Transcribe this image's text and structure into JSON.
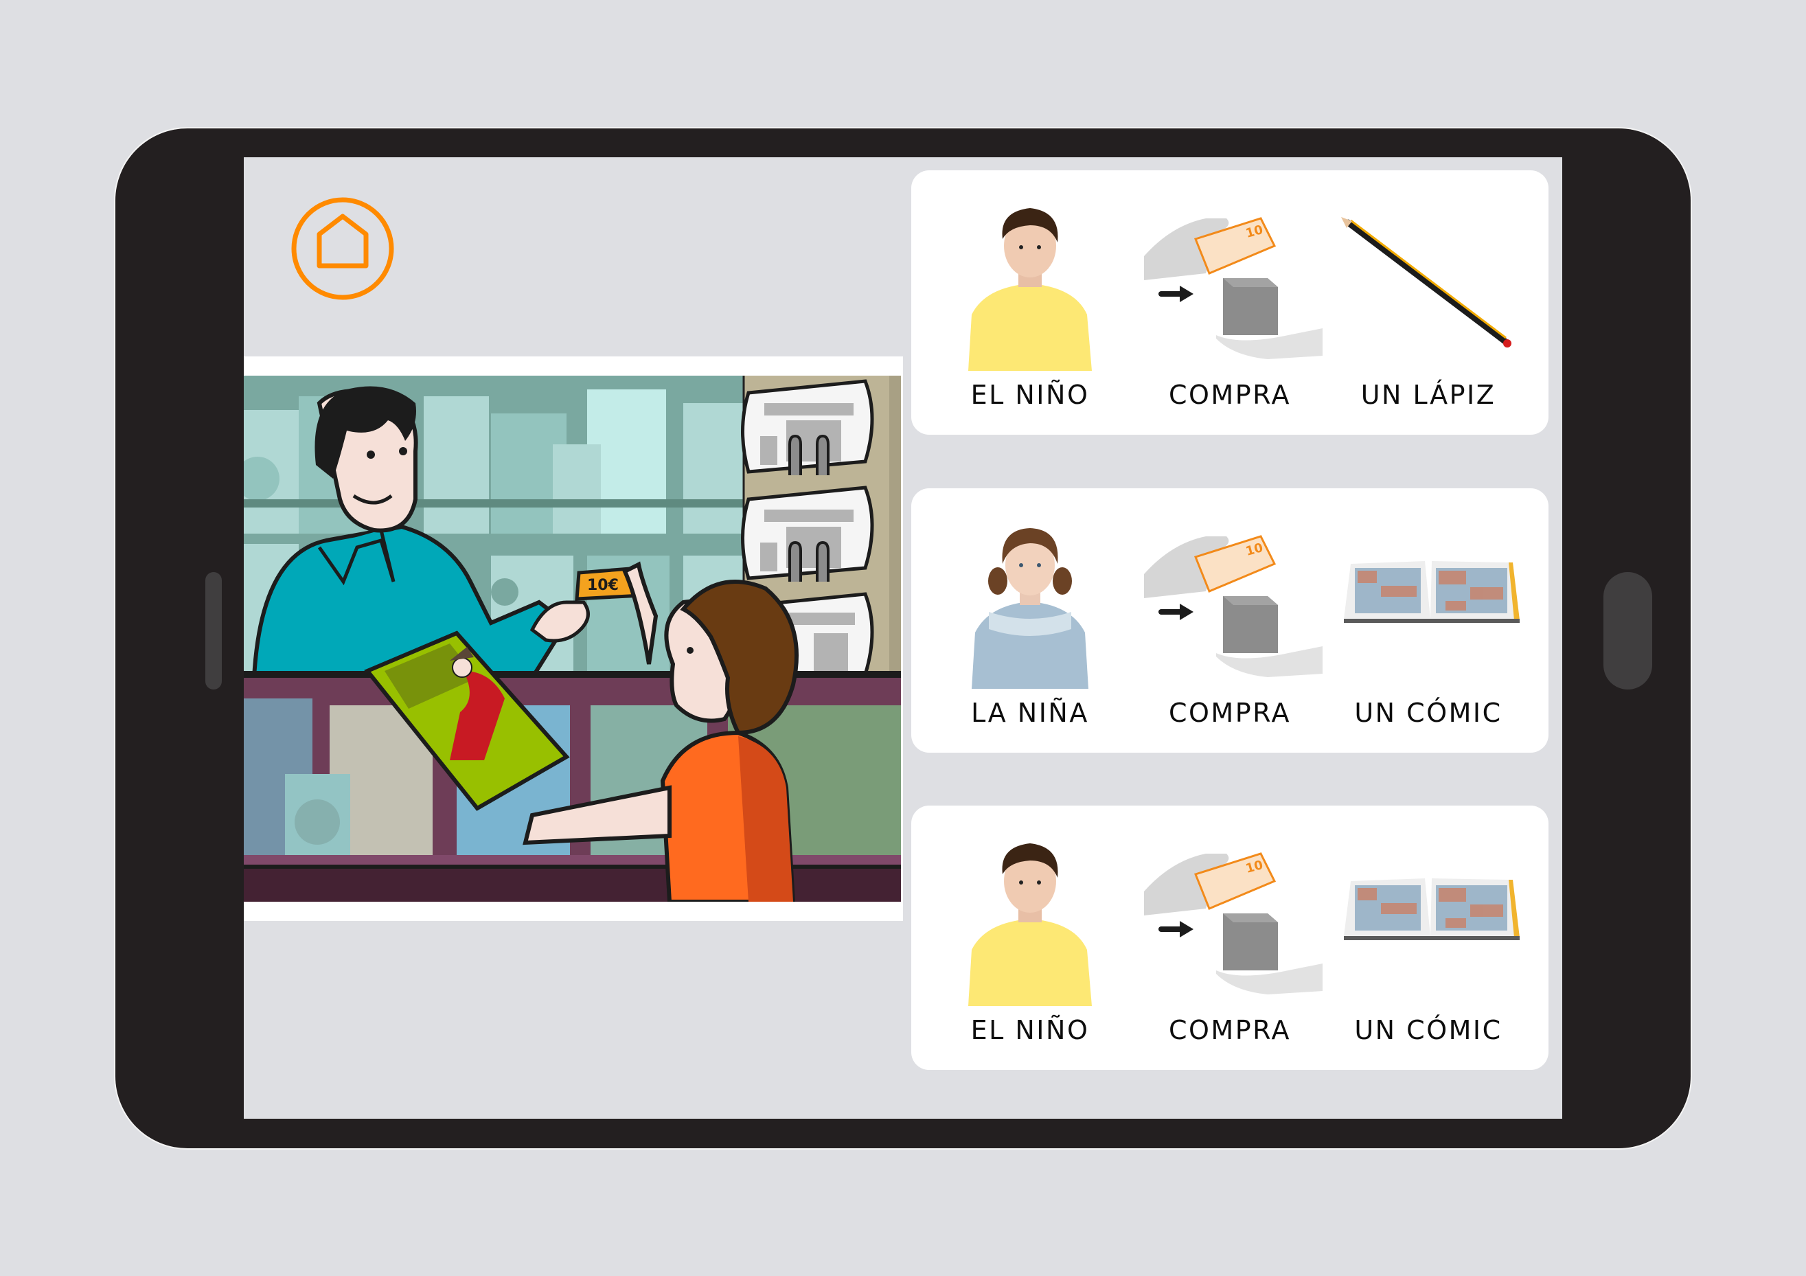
{
  "app": {
    "home_button": {
      "icon": "home-icon",
      "accent_color": "#ff8a00"
    }
  },
  "scene": {
    "description": "Man at newsstand counter hands a comic book to a boy who gives him a 10 euro note",
    "banknote_label": "10€"
  },
  "sentences": [
    {
      "words": [
        {
          "label": "EL NIÑO",
          "picto": "boy-photo"
        },
        {
          "label": "COMPRA",
          "picto": "buy-pictogram"
        },
        {
          "label": "UN LÁPIZ",
          "picto": "pencil-photo"
        }
      ]
    },
    {
      "words": [
        {
          "label": "LA NIÑA",
          "picto": "girl-photo"
        },
        {
          "label": "COMPRA",
          "picto": "buy-pictogram"
        },
        {
          "label": "UN CÓMIC",
          "picto": "comic-photo"
        }
      ]
    },
    {
      "words": [
        {
          "label": "EL NIÑO",
          "picto": "boy-photo"
        },
        {
          "label": "COMPRA",
          "picto": "buy-pictogram"
        },
        {
          "label": "UN CÓMIC",
          "picto": "comic-photo"
        }
      ]
    }
  ],
  "pictogram_note_value": "10",
  "colors": {
    "accent": "#ff8a00",
    "device_frame": "#231f20",
    "screen_bg": "#dedfe3",
    "card_bg": "#ffffff"
  }
}
